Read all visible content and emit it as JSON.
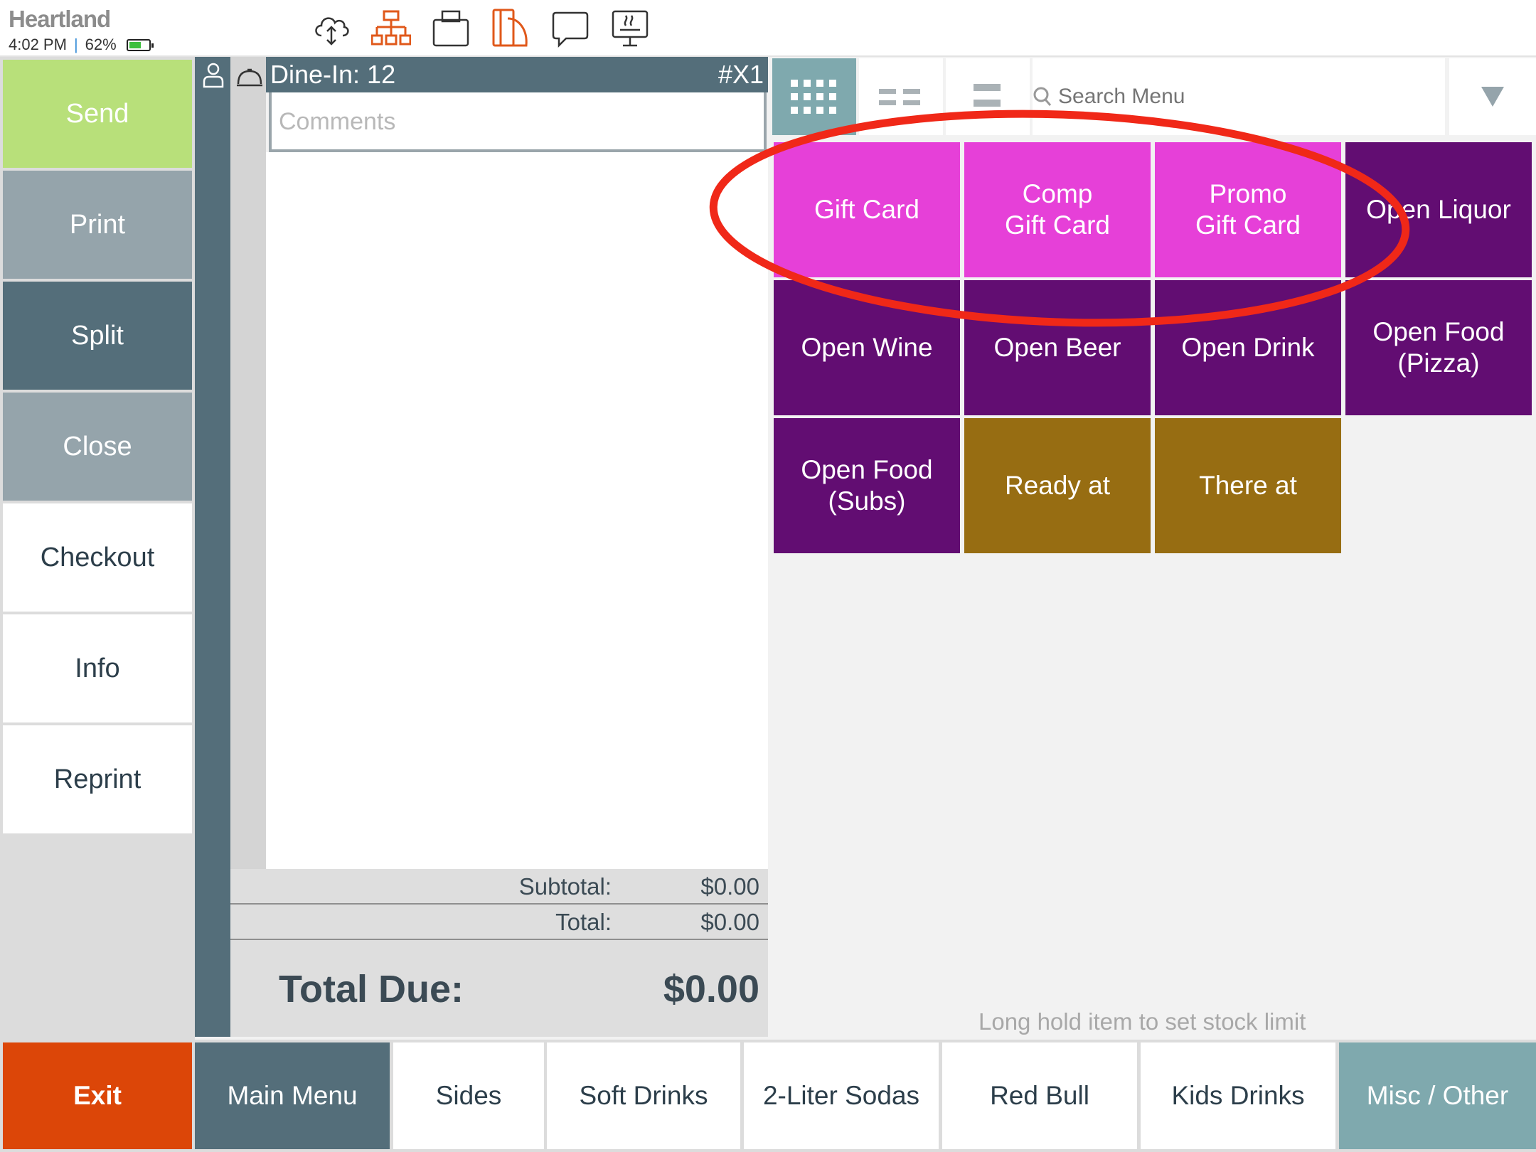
{
  "status_bar": {
    "brand": "Heartland",
    "time": "4:02 PM",
    "separator": "|",
    "battery": "62%",
    "battery_level": 0.62,
    "battery_color": "#3cbf3c",
    "icons": [
      "cloud-sync-icon",
      "network-icon",
      "cash-drawer-icon",
      "card-reader-icon",
      "message-icon",
      "kitchen-display-icon"
    ]
  },
  "actions": {
    "send": "Send",
    "print": "Print",
    "split": "Split",
    "close": "Close",
    "checkout": "Checkout",
    "info": "Info",
    "reprint": "Reprint",
    "exit": "Exit"
  },
  "order": {
    "title": "Dine-In: 12",
    "number": "#X1",
    "comments_placeholder": "Comments",
    "subtotal_label": "Subtotal:",
    "subtotal": "$0.00",
    "total_label": "Total:",
    "total": "$0.00",
    "total_due_label": "Total Due:",
    "total_due": "$0.00"
  },
  "toolbar": {
    "search_placeholder": "Search Menu",
    "active_view": "grid"
  },
  "menu_items": [
    {
      "label": "Gift Card",
      "color": "#e640d8"
    },
    {
      "label": "Comp\nGift Card",
      "color": "#e640d8"
    },
    {
      "label": "Promo\nGift Card",
      "color": "#e640d8"
    },
    {
      "label": "Open Liquor",
      "color": "#620d72"
    },
    {
      "label": "Open Wine",
      "color": "#620d72"
    },
    {
      "label": "Open Beer",
      "color": "#620d72"
    },
    {
      "label": "Open Drink",
      "color": "#620d72"
    },
    {
      "label": "Open Food\n(Pizza)",
      "color": "#620d72"
    },
    {
      "label": "Open Food\n(Subs)",
      "color": "#620d72"
    },
    {
      "label": "Ready at",
      "color": "#976d12"
    },
    {
      "label": "There at",
      "color": "#976d12"
    }
  ],
  "hint": "Long hold item to set stock limit",
  "categories": [
    {
      "label": "Main Menu",
      "state": "selected"
    },
    {
      "label": "Sides"
    },
    {
      "label": "Soft Drinks"
    },
    {
      "label": "2-Liter Sodas"
    },
    {
      "label": "Red Bull"
    },
    {
      "label": "Kids Drinks"
    },
    {
      "label": "Misc / Other",
      "state": "current"
    }
  ],
  "colors": {
    "send": "#b8e07a",
    "print": "#95a4ab",
    "split": "#546e7a",
    "close": "#95a4ab",
    "exit": "#dc4608",
    "header": "#546e7a",
    "active_view": "#7fa9ae",
    "misc_category": "#7fa9ae",
    "annotation": "#f02818",
    "orange_icon": "#e0581a"
  }
}
